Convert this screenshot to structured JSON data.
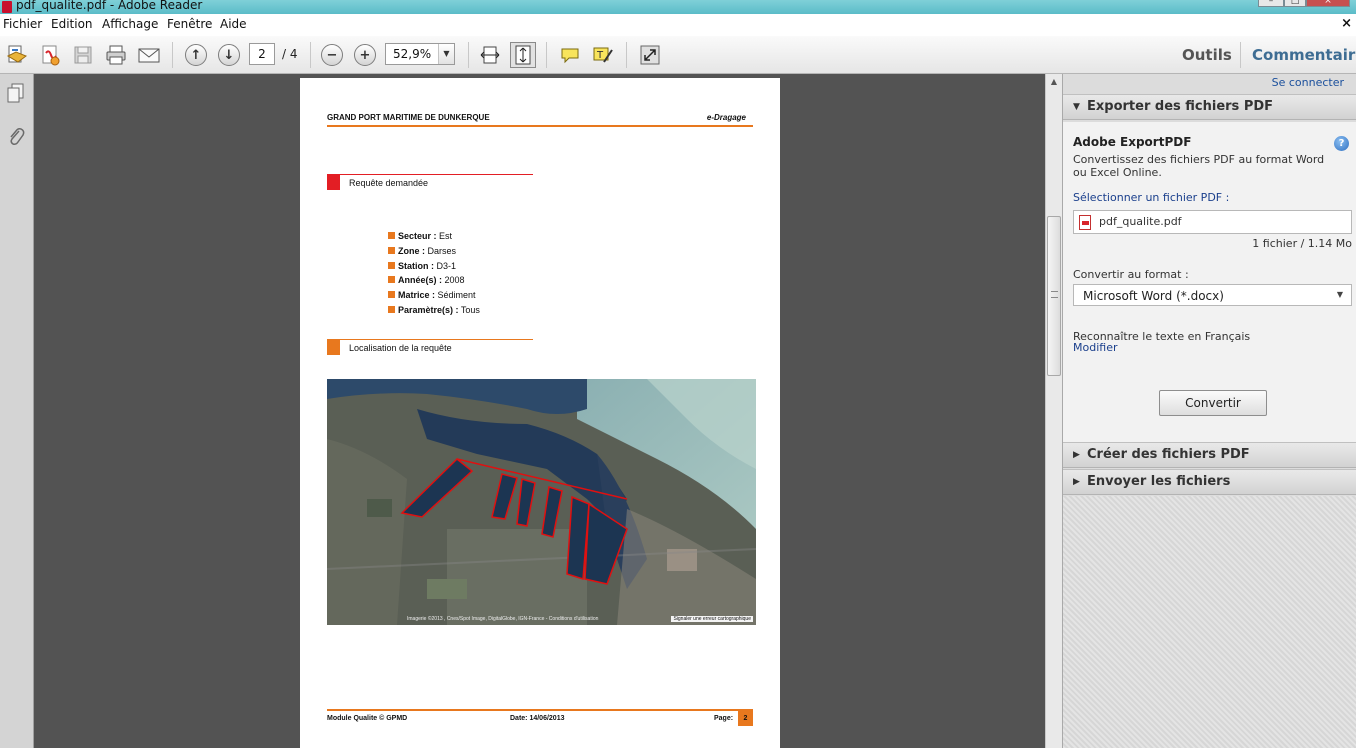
{
  "window": {
    "title": "pdf_qualite.pdf - Adobe Reader",
    "win_buttons": [
      "–",
      "□",
      "×"
    ]
  },
  "menu": {
    "items": [
      "Fichier",
      "Edition",
      "Affichage",
      "Fenêtre",
      "Aide"
    ],
    "close": "×"
  },
  "toolbar": {
    "page_current": "2",
    "page_total": "/ 4",
    "zoom": "52,9%",
    "tools_label": "Outils",
    "comment_label": "Commentaire"
  },
  "document": {
    "header_left": "GRAND PORT MARITIME DE DUNKERQUE",
    "header_right": "e-Dragage",
    "section1": "Requête demandée",
    "criteria": [
      {
        "key": "Secteur :",
        "value": " Est"
      },
      {
        "key": "Zone :",
        "value": " Darses"
      },
      {
        "key": "Station :",
        "value": " D3-1"
      },
      {
        "key": "Année(s) :",
        "value": " 2008"
      },
      {
        "key": "Matrice :",
        "value": " Sédiment"
      },
      {
        "key": "Paramètre(s) :",
        "value": " Tous"
      }
    ],
    "section2": "Localisation de la requête",
    "map_credit": "Imagerie ©2013 , Cnes/Spot Image, DigitalGlobe, IGN-France - Conditions d'utilisation",
    "map_report": "Signaler une erreur cartographique",
    "footer_left": "Module Qualite © GPMD",
    "footer_date": "Date: 14/06/2013",
    "footer_page_label": "Page:",
    "footer_page_num": "2"
  },
  "task_pane": {
    "connect": "Se connecter",
    "export_header": "Exporter des fichiers PDF",
    "export_title": "Adobe ExportPDF",
    "export_desc": "Convertissez des fichiers PDF au format Word ou Excel Online.",
    "select_label": "Sélectionner un fichier PDF :",
    "file_name": "pdf_qualite.pdf",
    "file_info": "1 fichier / 1.14 Mo",
    "format_label": "Convertir au format :",
    "format_value": "Microsoft Word (*.docx)",
    "ocr_text": "Reconnaître le texte en Français",
    "ocr_link": "Modifier",
    "convert_button": "Convertir",
    "create_header": "Créer des fichiers PDF",
    "send_header": "Envoyer les fichiers"
  },
  "icons": [
    "open-icon",
    "create-pdf-icon",
    "save-icon",
    "print-icon",
    "email-icon",
    "prev-page-icon",
    "next-page-icon",
    "zoom-out-icon",
    "zoom-in-icon",
    "fit-width-icon",
    "fit-page-icon",
    "sticky-note-icon",
    "highlight-icon",
    "fullscreen-icon",
    "pages-panel-icon",
    "attachments-icon"
  ],
  "colors": {
    "accent_orange": "#e8781e",
    "section_red": "#e31e24",
    "link_blue": "#1a3f8c",
    "polygon_red": "#e01010"
  }
}
